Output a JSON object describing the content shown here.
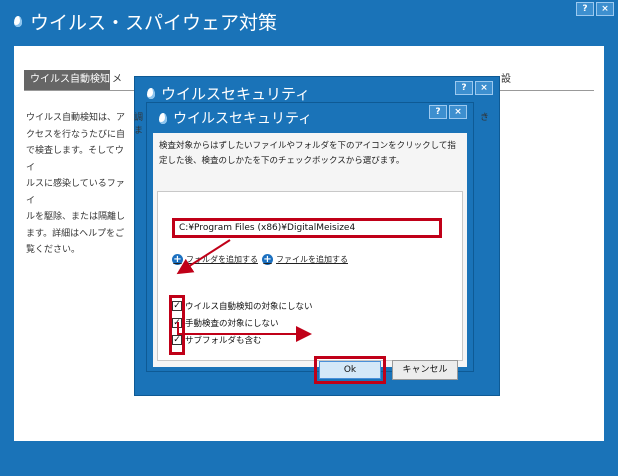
{
  "outer_window": {
    "title": "ウイルス・スパイウェア対策",
    "help_label": "?",
    "close_label": "×",
    "tab_active": "ウイルス自動検知",
    "tab_partial": "メ",
    "tab_right_partial": "設",
    "description": "ウイルス自動検知は、ア\nクセスを行なうたびに自\nで検査します。そしてウイ\nルスに感染しているファイ\nルを駆除、または隔離し\nます。詳細はヘルプをご\n覧ください。"
  },
  "middle_dialog": {
    "title": "ウイルスセキュリティ",
    "help_label": "?",
    "close_label": "×",
    "partial_1": "調",
    "partial_2": "ま",
    "partial_right": "き"
  },
  "inner_dialog": {
    "title": "ウイルスセキュリティ",
    "help_label": "?",
    "close_label": "×",
    "instruction": "検査対象からはずしたいファイルやフォルダを下のアイコンをクリックして指定した後、検査のしかたを下のチェックボックスから選びます。",
    "path_value": "C:¥Program Files (x86)¥DigitalMeisize4",
    "add_folder": "フォルダを追加する",
    "add_file": "ファイルを追加する",
    "checkboxes": [
      {
        "label": "ウイルス自動検知の対象にしない",
        "checked": true
      },
      {
        "label": "手動検査の対象にしない",
        "checked": true
      },
      {
        "label": "サブフォルダも含む",
        "checked": true
      }
    ],
    "check_mark": "✓",
    "ok_label": "Ok",
    "cancel_label": "キャンセル"
  },
  "colors": {
    "window_blue": "#1a73b8",
    "highlight_red": "#c00018"
  }
}
